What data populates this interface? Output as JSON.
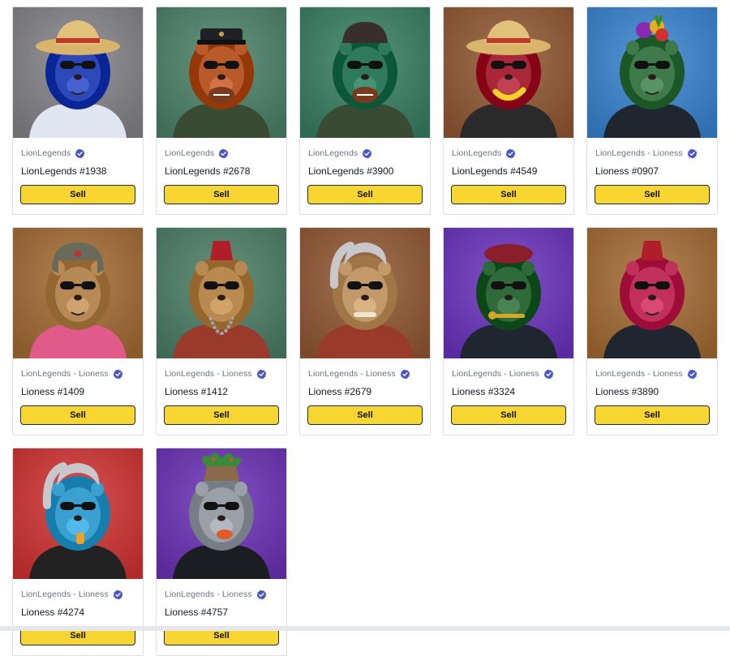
{
  "actions": {
    "sell_label": "Sell"
  },
  "cards": [
    {
      "collection": "LionLegends",
      "name": "LionLegends #1938",
      "bg": "#6f6f73",
      "fur": "#2d48b8",
      "outfit": "#dfe6f2",
      "hat": "straw",
      "accessory": "none"
    },
    {
      "collection": "LionLegends",
      "name": "LionLegends #2678",
      "bg": "#3f6d57",
      "fur": "#b85a2a",
      "outfit": "#3a4b33",
      "hat": "captain",
      "accessory": "football"
    },
    {
      "collection": "LionLegends",
      "name": "LionLegends #3900",
      "bg": "#2f6a52",
      "fur": "#2f7a5c",
      "outfit": "#3a4b33",
      "hat": "beanie",
      "accessory": "football"
    },
    {
      "collection": "LionLegends",
      "name": "LionLegends #4549",
      "bg": "#7a4a2a",
      "fur": "#a8283a",
      "outfit": "#2a2a2a",
      "hat": "straw",
      "accessory": "banana"
    },
    {
      "collection": "LionLegends - Lioness",
      "name": "Lioness #0907",
      "bg": "#2f6fb0",
      "fur": "#3f7a4a",
      "outfit": "#1f2630",
      "hat": "fruit",
      "accessory": "none"
    },
    {
      "collection": "LionLegends - Lioness",
      "name": "Lioness #1409",
      "bg": "#8a5a2a",
      "fur": "#b78a55",
      "outfit": "#e05a8a",
      "hat": "ushanka",
      "accessory": "none"
    },
    {
      "collection": "LionLegends - Lioness",
      "name": "Lioness #1412",
      "bg": "#3f6a55",
      "fur": "#b88a50",
      "outfit": "#9a3a2a",
      "hat": "fez",
      "accessory": "chain"
    },
    {
      "collection": "LionLegends - Lioness",
      "name": "Lioness #2679",
      "bg": "#7a4a2a",
      "fur": "#c29a6a",
      "outfit": "#9a3a2a",
      "hat": "ponytail",
      "accessory": "bone"
    },
    {
      "collection": "LionLegends - Lioness",
      "name": "Lioness #3324",
      "bg": "#5a2aa0",
      "fur": "#2f6a3a",
      "outfit": "#1f2630",
      "hat": "beret",
      "accessory": "key"
    },
    {
      "collection": "LionLegends - Lioness",
      "name": "Lioness #3890",
      "bg": "#8a5a2a",
      "fur": "#c0305a",
      "outfit": "#1f2630",
      "hat": "fez",
      "accessory": "none"
    },
    {
      "collection": "LionLegends - Lioness",
      "name": "Lioness #4274",
      "bg": "#b02a2a",
      "fur": "#3aa0d0",
      "outfit": "#222",
      "hat": "ponytail",
      "accessory": "whistle"
    },
    {
      "collection": "LionLegends - Lioness",
      "name": "Lioness #4757",
      "bg": "#5a2a9a",
      "fur": "#9aa0a8",
      "outfit": "#1a1d22",
      "hat": "plant",
      "accessory": "lips"
    }
  ]
}
